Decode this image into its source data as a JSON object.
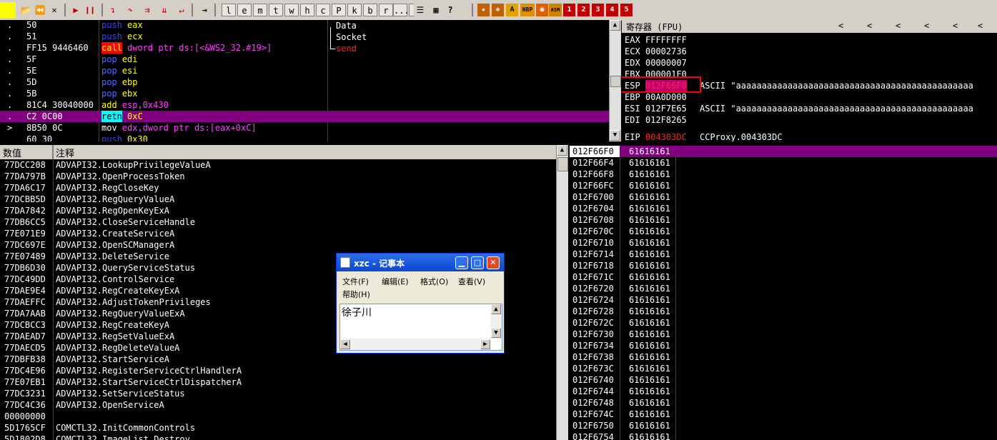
{
  "toolbar": {
    "file_buttons": [
      "open-icon",
      "rewind-icon",
      "close-icon",
      "run-icon",
      "pause-icon",
      "step-into-icon",
      "step-over-icon",
      "trace-into-icon",
      "trace-over-icon",
      "execute-till-return-icon",
      "go-to-icon"
    ],
    "window_letters": [
      "l",
      "e",
      "m",
      "t",
      "w",
      "h",
      "c",
      "P",
      "k",
      "b",
      "r",
      "...",
      "s"
    ],
    "right_icons": [
      "list-icon",
      "grid-icon",
      "help-icon"
    ],
    "plugin_labels": [
      "HBP",
      "ASM"
    ],
    "number_buttons": [
      "1",
      "2",
      "3",
      "4",
      "5"
    ]
  },
  "cpu": {
    "rows": [
      {
        "addr": ".",
        "bytes": "50",
        "instr_kw": "push",
        "instr_arg": "eax"
      },
      {
        "addr": ".",
        "bytes": "51",
        "instr_kw": "push",
        "instr_arg": "ecx"
      },
      {
        "addr": ".",
        "bytes": "FF15 9446460",
        "instr_kw": "call",
        "instr_arg": "dword ptr ds:[<&WS2_32.#19>]"
      },
      {
        "addr": ".",
        "bytes": "5F",
        "instr_kw": "pop",
        "instr_arg": "edi"
      },
      {
        "addr": ".",
        "bytes": "5E",
        "instr_kw": "pop",
        "instr_arg": "esi"
      },
      {
        "addr": ".",
        "bytes": "5D",
        "instr_kw": "pop",
        "instr_arg": "ebp"
      },
      {
        "addr": ".",
        "bytes": "5B",
        "instr_kw": "pop",
        "instr_arg": "ebx"
      },
      {
        "addr": ".",
        "bytes": "81C4 30040000",
        "instr_kw": "add",
        "instr_arg": "esp,0x430"
      },
      {
        "addr": ".",
        "bytes": "C2 0C00",
        "instr_kw": "retn",
        "instr_arg": "0xC"
      },
      {
        "addr": ">",
        "bytes": "8B50 0C",
        "instr_kw": "mov",
        "instr_arg": "edx,dword ptr ds:[eax+0xC]"
      },
      {
        "addr": "",
        "bytes": "60 30",
        "instr_kw": "push",
        "instr_arg": "0x30"
      }
    ],
    "comments": [
      "Data",
      "Socket",
      "send"
    ]
  },
  "registers": {
    "header": "寄存器 (FPU)",
    "arrows": [
      "<",
      "<",
      "<",
      "<",
      "<",
      "<",
      "<"
    ],
    "lines": [
      {
        "name": "EAX",
        "value": "FFFFFFFF",
        "extra": ""
      },
      {
        "name": "ECX",
        "value": "00002736",
        "extra": ""
      },
      {
        "name": "EDX",
        "value": "00000007",
        "extra": ""
      },
      {
        "name": "EBX",
        "value": "000001F0",
        "extra": ""
      },
      {
        "name": "ESP",
        "value": "012F66F0",
        "extra": "ASCII \"aaaaaaaaaaaaaaaaaaaaaaaaaaaaaaaaaaaaaaaaaaaaaa"
      },
      {
        "name": "EBP",
        "value": "00A0D000",
        "extra": ""
      },
      {
        "name": "ESI",
        "value": "012F7E65",
        "extra": "ASCII \"aaaaaaaaaaaaaaaaaaaaaaaaaaaaaaaaaaaaaaaaaaaaaa"
      },
      {
        "name": "EDI",
        "value": "012F8265",
        "extra": ""
      },
      {
        "name": "EIP",
        "value": "004303DC",
        "extra": "CCProxy.004303DC"
      }
    ]
  },
  "imports": {
    "col_value": "数值",
    "col_comment": "注释",
    "rows": [
      [
        "77DCC208",
        "ADVAPI32.LookupPrivilegeValueA"
      ],
      [
        "77DA797B",
        "ADVAPI32.OpenProcessToken"
      ],
      [
        "77DA6C17",
        "ADVAPI32.RegCloseKey"
      ],
      [
        "77DCBB5D",
        "ADVAPI32.RegQueryValueA"
      ],
      [
        "77DA7842",
        "ADVAPI32.RegOpenKeyExA"
      ],
      [
        "77DB6CC5",
        "ADVAPI32.CloseServiceHandle"
      ],
      [
        "77E071E9",
        "ADVAPI32.CreateServiceA"
      ],
      [
        "77DC697E",
        "ADVAPI32.OpenSCManagerA"
      ],
      [
        "77E07489",
        "ADVAPI32.DeleteService"
      ],
      [
        "77DB6D30",
        "ADVAPI32.QueryServiceStatus"
      ],
      [
        "77DC49DD",
        "ADVAPI32.ControlService"
      ],
      [
        "77DAE9E4",
        "ADVAPI32.RegCreateKeyExA"
      ],
      [
        "77DAEFFC",
        "ADVAPI32.AdjustTokenPrivileges"
      ],
      [
        "77DA7AAB",
        "ADVAPI32.RegQueryValueExA"
      ],
      [
        "77DCBCC3",
        "ADVAPI32.RegCreateKeyA"
      ],
      [
        "77DAEAD7",
        "ADVAPI32.RegSetValueExA"
      ],
      [
        "77DAECD5",
        "ADVAPI32.RegDeleteValueA"
      ],
      [
        "77DBFB38",
        "ADVAPI32.StartServiceA"
      ],
      [
        "77DC4E96",
        "ADVAPI32.RegisterServiceCtrlHandlerA"
      ],
      [
        "77E07EB1",
        "ADVAPI32.StartServiceCtrlDispatcherA"
      ],
      [
        "77DC3231",
        "ADVAPI32.SetServiceStatus"
      ],
      [
        "77DC4C36",
        "ADVAPI32.OpenServiceA"
      ],
      [
        "00000000",
        ""
      ],
      [
        "5D1765CF",
        "COMCTL32.InitCommonControls"
      ],
      [
        "5D1802D8",
        "COMCTL32.ImageList_Destroy"
      ]
    ]
  },
  "stack": {
    "rows": [
      [
        "012F66F0",
        "61616161"
      ],
      [
        "012F66F4",
        "61616161"
      ],
      [
        "012F66F8",
        "61616161"
      ],
      [
        "012F66FC",
        "61616161"
      ],
      [
        "012F6700",
        "61616161"
      ],
      [
        "012F6704",
        "61616161"
      ],
      [
        "012F6708",
        "61616161"
      ],
      [
        "012F670C",
        "61616161"
      ],
      [
        "012F6710",
        "61616161"
      ],
      [
        "012F6714",
        "61616161"
      ],
      [
        "012F6718",
        "61616161"
      ],
      [
        "012F671C",
        "61616161"
      ],
      [
        "012F6720",
        "61616161"
      ],
      [
        "012F6724",
        "61616161"
      ],
      [
        "012F6728",
        "61616161"
      ],
      [
        "012F672C",
        "61616161"
      ],
      [
        "012F6730",
        "61616161"
      ],
      [
        "012F6734",
        "61616161"
      ],
      [
        "012F6738",
        "61616161"
      ],
      [
        "012F673C",
        "61616161"
      ],
      [
        "012F6740",
        "61616161"
      ],
      [
        "012F6744",
        "61616161"
      ],
      [
        "012F6748",
        "61616161"
      ],
      [
        "012F674C",
        "61616161"
      ],
      [
        "012F6750",
        "61616161"
      ],
      [
        "012F6754",
        "61616161"
      ]
    ]
  },
  "notepad": {
    "title": "xzc - 记事本",
    "menus": [
      "文件(F)",
      "编辑(E)",
      "格式(O)",
      "查看(V)",
      "帮助(H)"
    ],
    "content": "徐子川"
  },
  "colors": {
    "selection": "#800080",
    "highlight_box": "#ff0000",
    "toolbar": "#d4d0c8"
  }
}
